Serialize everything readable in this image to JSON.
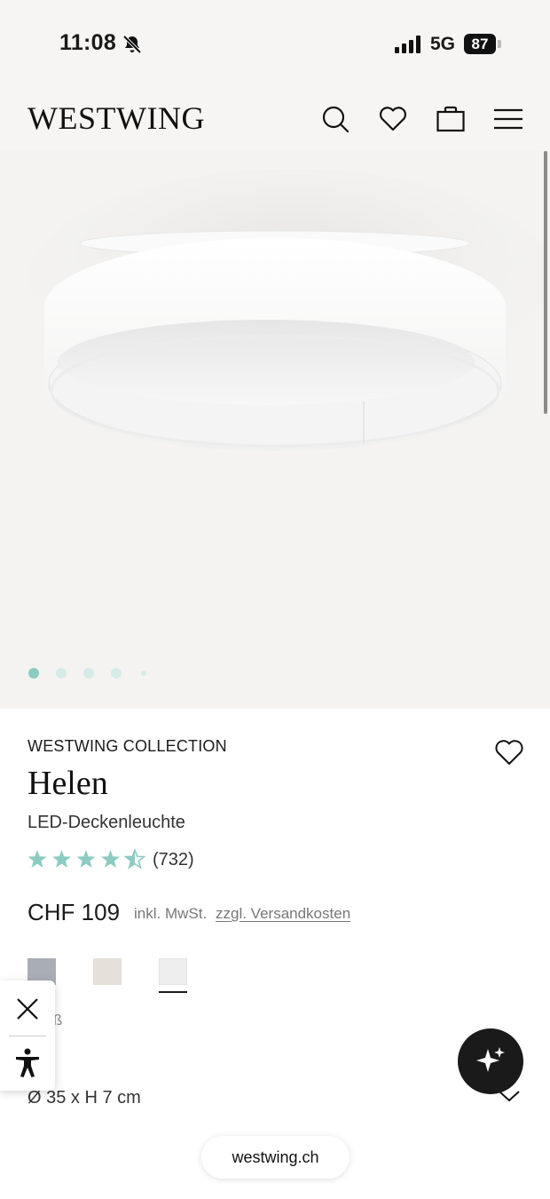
{
  "status_bar": {
    "time": "11:08",
    "network": "5G",
    "battery": "87"
  },
  "header": {
    "logo": "WESTWING"
  },
  "gallery": {
    "active_index": 0,
    "dot_count": 5,
    "accent_color": "#8ccbc2",
    "inactive_color": "#d5ebe8"
  },
  "product": {
    "brand": "WESTWING COLLECTION",
    "name": "Helen",
    "subtitle": "LED-Deckenleuchte",
    "rating": 4.5,
    "rating_max": 5,
    "review_count": "(732)",
    "price": "CHF 109",
    "tax_note": "inkl. MwSt.",
    "shipping_link": "zzgl. Versandkosten",
    "swatches": [
      {
        "color": "#a9aeb6",
        "selected": false
      },
      {
        "color": "#e6e0da",
        "selected": false
      },
      {
        "color": "#eeeeee",
        "selected": true
      }
    ],
    "selected_color_fragment": "ß",
    "dimensions": "Ø 35 x H 7 cm"
  },
  "footer": {
    "url": "westwing.ch"
  },
  "colors": {
    "star": "#8ccbc2",
    "dark": "#1a1a1a"
  }
}
